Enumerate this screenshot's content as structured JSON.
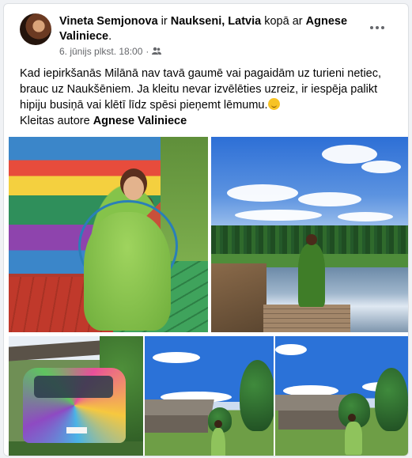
{
  "post": {
    "author": "Vineta Semjonova",
    "connector_is": "ir",
    "location": "Naukseni, Latvia",
    "connector_with": "kopā ar",
    "tagged": "Agnese Valiniece",
    "tagged_suffix": ".",
    "date": "6. jūnijs plkst. 18:00",
    "separator": "·",
    "audience_icon": "friends-icon",
    "more_icon": "more-options-icon"
  },
  "body": {
    "text": "Kad iepirkšanās Milānā  nav tavā  gaumē vai pagaidām  uz turieni netiec, brauc uz Naukšēniem. Ja kleitu  nevar izvēlēties  uzreiz, ir iespēja palikt  hipiju  busiņā vai klētī  līdz  spēsi pieņemt  lēmumu.",
    "emoji_icon": "wink-emoji-icon",
    "credit_label": "Kleitas autore ",
    "credit_name": "Agnese Valiniece"
  },
  "colors": {
    "link_text": "#050505",
    "meta_text": "#65676b",
    "card_bg": "#ffffff",
    "page_bg": "#f0f2f5"
  }
}
